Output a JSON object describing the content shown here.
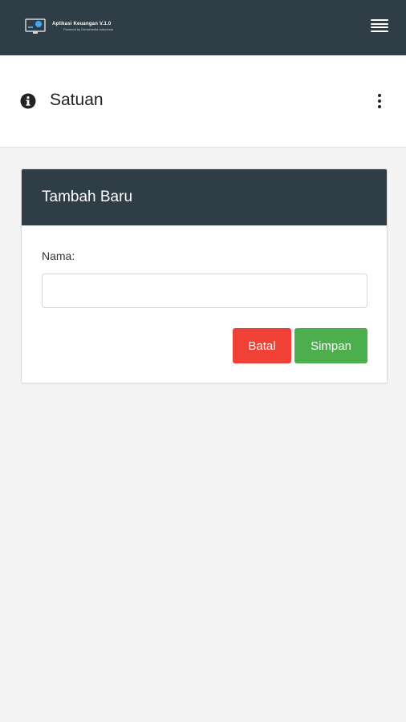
{
  "app": {
    "title": "Aplikasi Keuangan V.1.0",
    "subtitle": "Powered by Donwmedia Indonesia",
    "header_color": "#2f3e46"
  },
  "icons": {
    "menu": "hamburger-menu-icon",
    "info": "info-circle-icon",
    "more": "vertical-dots-icon"
  },
  "page": {
    "title": "Satuan"
  },
  "form": {
    "header": "Tambah Baru",
    "name_label": "Nama:",
    "name_value": "",
    "name_placeholder": "",
    "cancel_label": "Batal",
    "save_label": "Simpan",
    "cancel_color": "#ef4135",
    "save_color": "#4cae4c"
  }
}
